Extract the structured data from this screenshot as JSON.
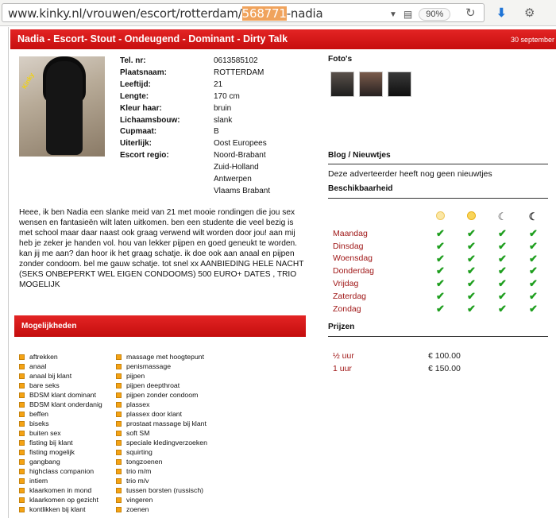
{
  "browser": {
    "url_prefix": "www.kinky.nl/vrouwen/escort/rotterdam/",
    "url_highlight": "568771",
    "url_suffix": "-nadia",
    "zoom": "90%"
  },
  "title": {
    "text": "Nadia - Escort- Stout - Ondeugend - Dominant - Dirty Talk",
    "date": "30 september"
  },
  "photo": {
    "watermark": "Kinky"
  },
  "info": [
    {
      "key": "Tel. nr:",
      "value": "0613585102"
    },
    {
      "key": "Plaatsnaam:",
      "value": "ROTTERDAM"
    },
    {
      "key": "Leeftijd:",
      "value": "21"
    },
    {
      "key": "Lengte:",
      "value": "170 cm"
    },
    {
      "key": "Kleur haar:",
      "value": "bruin"
    },
    {
      "key": "Lichaamsbouw:",
      "value": "slank"
    },
    {
      "key": "Cupmaat:",
      "value": "B"
    },
    {
      "key": "Uiterlijk:",
      "value": "Oost Europees"
    },
    {
      "key": "Escort regio:",
      "value": "Noord-Brabant"
    },
    {
      "key": "",
      "value": "Zuid-Holland"
    },
    {
      "key": "",
      "value": "Antwerpen"
    },
    {
      "key": "",
      "value": "Vlaams Brabant"
    }
  ],
  "description": "Heee, ik ben Nadia een slanke meid van 21 met mooie rondingen die jou sex wensen en fantasieën wilt laten uitkomen. ben een studente die veel bezig is met school maar daar naast ook graag verwend wilt worden door jou! aan mij heb je zeker je handen vol. hou van lekker pijpen en goed geneukt te worden. kan jij me aan? dan hoor ik het graag schatje. ik doe ook aan anaal en pijpen zonder condoom. bel me gauw schatje. tot snel xx AANBIEDING HELE NACHT (SEKS ONBEPERKT WEL EIGEN CONDOOMS) 500 EURO+ DATES , TRIO MOGELIJK",
  "mogelijkheden": {
    "title": "Mogelijkheden",
    "col1": [
      "aftrekken",
      "anaal",
      "anaal bij klant",
      "bare seks",
      "BDSM klant dominant",
      "BDSM klant onderdanig",
      "beffen",
      "biseks",
      "buiten sex",
      "fisting bij klant",
      "fisting mogelijk",
      "gangbang",
      "highclass companion",
      "intiem",
      "klaarkomen in mond",
      "klaarkomen op gezicht",
      "kontlikken bij klant"
    ],
    "col2": [
      "massage met hoogtepunt",
      "penismassage",
      "pijpen",
      "pijpen deepthroat",
      "pijpen zonder condoom",
      "plassex",
      "plassex door klant",
      "prostaat massage bij klant",
      "soft SM",
      "speciale kledingverzoeken",
      "squirting",
      "tongzoenen",
      "trio m/m",
      "trio m/v",
      "tussen borsten (russisch)",
      "vingeren",
      "zoenen"
    ]
  },
  "right": {
    "fotos_title": "Foto's",
    "blog_title": "Blog / Nieuwtjes",
    "no_news": "Deze adverteerder heeft nog geen nieuwtjes",
    "availability_title": "Beschikbaarheid",
    "days": [
      "Maandag",
      "Dinsdag",
      "Woensdag",
      "Donderdag",
      "Vrijdag",
      "Zaterdag",
      "Zondag"
    ],
    "check": "✔",
    "prices_title": "Prijzen",
    "prices": [
      {
        "duration": "½  uur",
        "amount": "€ 100.00"
      },
      {
        "duration": "1  uur",
        "amount": "€ 150.00"
      }
    ]
  }
}
